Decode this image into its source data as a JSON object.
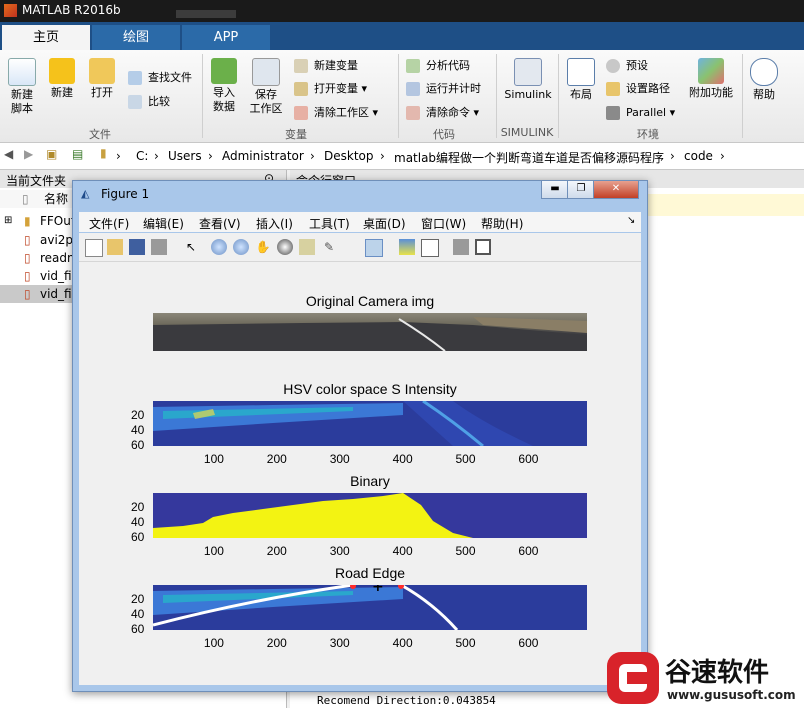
{
  "app": {
    "title": "MATLAB R2016b"
  },
  "tabs": [
    {
      "label": "主页",
      "active": true
    },
    {
      "label": "绘图",
      "active": false
    },
    {
      "label": "APP",
      "active": false
    }
  ],
  "ribbon": {
    "file": {
      "new_script": "新建\n脚本",
      "new": "新建",
      "open": "打开",
      "find_files": "查找文件",
      "compare": "比较",
      "group": "文件"
    },
    "variable": {
      "import_data": "导入\n数据",
      "save_workspace": "保存\n工作区",
      "new_variable": "新建变量",
      "open_variable": "打开变量",
      "clear_workspace": "清除工作区",
      "group": "变量"
    },
    "code": {
      "analyze_code": "分析代码",
      "run_and_time": "运行并计时",
      "clear_commands": "清除命令",
      "group": "代码"
    },
    "simulink": {
      "label": "Simulink",
      "group": "SIMULINK"
    },
    "environment": {
      "layout": "布局",
      "preferences": "预设",
      "set_path": "设置路径",
      "parallel": "Parallel",
      "addons": "附加功能",
      "group": "环境"
    },
    "help": {
      "label": "帮助"
    }
  },
  "address": {
    "crumbs": [
      "C:",
      "Users",
      "Administrator",
      "Desktop",
      "matlab编程做一个判断弯道车道是否偏移源码程序",
      "code"
    ]
  },
  "current_folder": {
    "title": "当前文件夹",
    "col_name": "名称",
    "items": [
      {
        "name": "FFOut"
      },
      {
        "name": "avi2p"
      },
      {
        "name": "readm"
      },
      {
        "name": "vid_fi"
      },
      {
        "name": "vid_fi"
      }
    ]
  },
  "command_window": {
    "title": "命令行窗口",
    "output": "Recomend Direction:0.043854"
  },
  "figure": {
    "title": "Figure 1",
    "menu": [
      "文件(F)",
      "编辑(E)",
      "查看(V)",
      "插入(I)",
      "工具(T)",
      "桌面(D)",
      "窗口(W)",
      "帮助(H)"
    ],
    "axes": [
      {
        "title": "Original Camera img",
        "xticks": [],
        "yticks": []
      },
      {
        "title": "HSV color space S Intensity",
        "xticks": [
          "100",
          "200",
          "300",
          "400",
          "500",
          "600"
        ],
        "yticks": [
          "20",
          "40",
          "60"
        ]
      },
      {
        "title": "Binary",
        "xticks": [
          "100",
          "200",
          "300",
          "400",
          "500",
          "600"
        ],
        "yticks": [
          "20",
          "40",
          "60"
        ]
      },
      {
        "title": "Road Edge",
        "xticks": [
          "100",
          "200",
          "300",
          "400",
          "500",
          "600"
        ],
        "yticks": [
          "20",
          "40",
          "60"
        ]
      }
    ]
  },
  "watermark": {
    "brand": "谷速软件",
    "url": "www.gususoft.com"
  },
  "colors": {
    "ribbon_tab_bar": "#1e4f86",
    "plot_dark_blue": "#2a3a9a",
    "binary_yellow": "#f3f312",
    "edge_marker": "#ff2b2b"
  }
}
